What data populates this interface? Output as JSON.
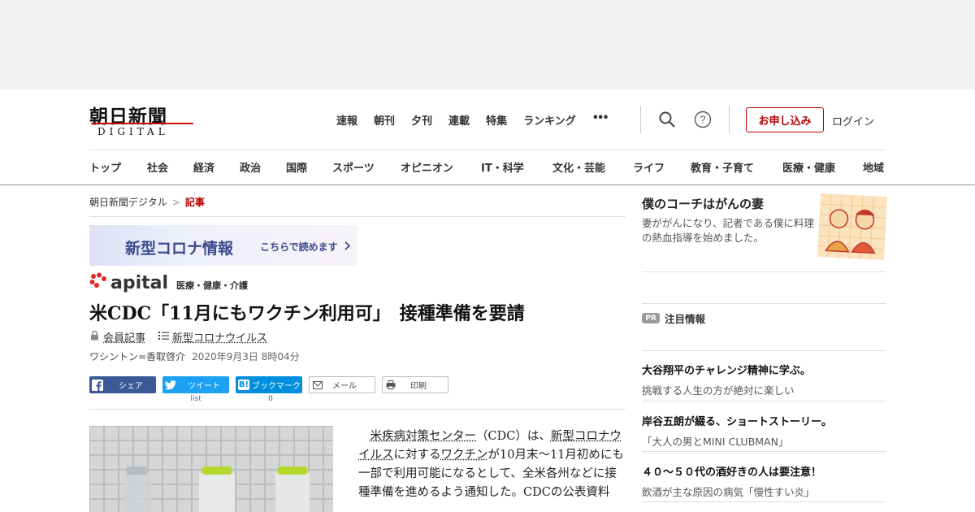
{
  "header": {
    "logo_main": "朝日新聞",
    "logo_sub": "DIGITAL",
    "top_nav": [
      "速報",
      "朝刊",
      "夕刊",
      "連載",
      "特集",
      "ランキング"
    ],
    "more": "•••",
    "apply_label": "お申し込み",
    "login_label": "ログイン",
    "categories": [
      "トップ",
      "社会",
      "経済",
      "政治",
      "国際",
      "スポーツ",
      "オピニオン",
      "IT・科学",
      "文化・芸能",
      "ライフ",
      "教育・子育て",
      "医療・健康",
      "地域"
    ]
  },
  "breadcrumb": {
    "home": "朝日新聞デジタル",
    "sep": ">",
    "current": "記事"
  },
  "banner": {
    "title": "新型コロナ情報",
    "link": "こちらで読めます"
  },
  "apital": {
    "name": "apital",
    "sub": "医療・健康・介護"
  },
  "article": {
    "headline": "米CDC「11月にもワクチン利用可」　接種準備を要請",
    "tag_member": "会員記事",
    "tag_topic": "新型コロナウイルス",
    "author": "ワシントン=香取啓介",
    "date": "2020年9月3日 8時04分",
    "body_indent": "　",
    "body_l1a": "米疾病対策センター",
    "body_l1b": "（CDC）は、",
    "body_l1c": "新型コロナウイルス",
    "body_l1d": "に対する",
    "body_l1e": "ワクチン",
    "body_l1f": "が10月末～11月初めにも一部で利用可能になるとして、全米各州などに接種準備を進めるよう通知した。CDCの公表資料"
  },
  "share": {
    "facebook": "シェア",
    "twitter": "ツイート",
    "twitter_count": "list",
    "hatena": "ブックマーク",
    "hatena_icon": "B!",
    "hatena_count": "0",
    "mail": "メール",
    "print": "印刷"
  },
  "sidebar": {
    "feature_title": "僕のコーチはがんの妻",
    "feature_desc": "妻ががんになり、記者である僕に料理の熱血指導を始めました。",
    "pr_badge": "PR",
    "pr_head": "注目情報",
    "pr_items": [
      {
        "title": "大谷翔平のチャレンジ精神に学ぶ。",
        "desc": "挑戦する人生の方が絶対に楽しい"
      },
      {
        "title": "岸谷五朗が綴る、ショートストーリー。",
        "desc": "「大人の男とMINI CLUBMAN」"
      },
      {
        "title": "４０～５０代の酒好きの人は要注意！",
        "desc": "飲酒が主な原因の病気「慢性すい炎」"
      }
    ]
  },
  "colors": {
    "accent_red": "#b00000",
    "facebook": "#3b5998",
    "twitter": "#1da1f2",
    "hatena": "#008fde"
  },
  "icons": [
    "search-icon",
    "help-icon",
    "lock-icon",
    "list-icon",
    "facebook-icon",
    "twitter-icon",
    "mail-icon",
    "print-icon",
    "chevron-right-icon"
  ]
}
